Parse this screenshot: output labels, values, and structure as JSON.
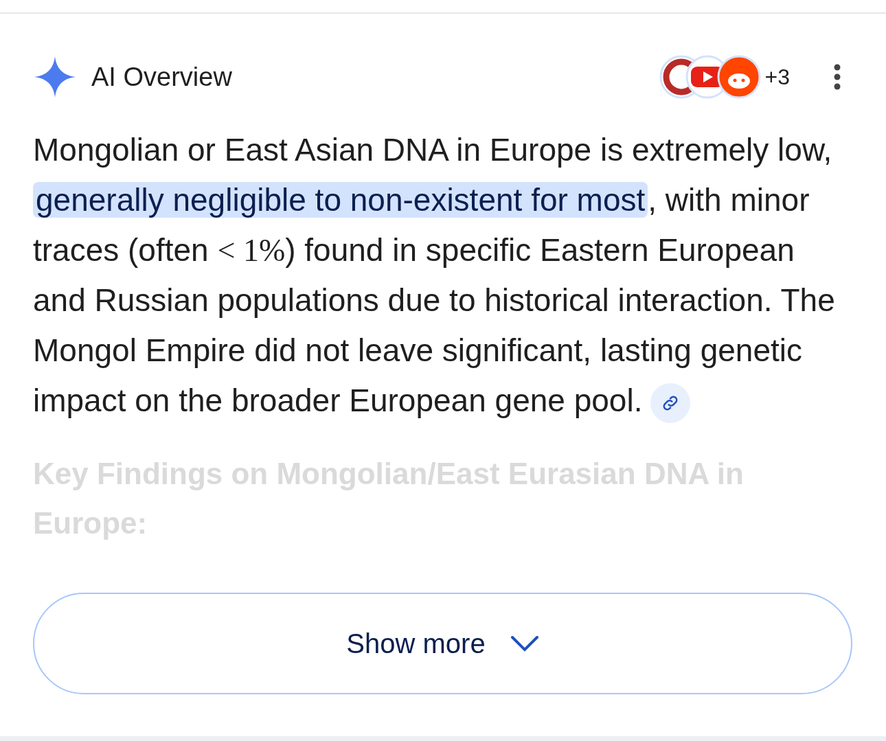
{
  "header": {
    "title": "AI Overview",
    "sources_more": "+3"
  },
  "paragraph": [
    {
      "kind": "plain",
      "text": "Mongolian or East Asian DNA in Europe is extremely low, "
    },
    {
      "kind": "highlight",
      "text": "generally negligible to non-existent for most"
    },
    {
      "kind": "plain",
      "text": ", with minor traces (often "
    },
    {
      "kind": "math",
      "text": "< 1%"
    },
    {
      "kind": "plain",
      "text": ") found in specific Eastern European and Russian populations due to historical interaction. The Mongol Empire did not leave significant, lasting genetic impact on the broader European gene pool."
    }
  ],
  "faded_heading": "Key Findings on Mongolian/East Eurasian DNA in Europe:",
  "show_more_button": "Show more"
}
